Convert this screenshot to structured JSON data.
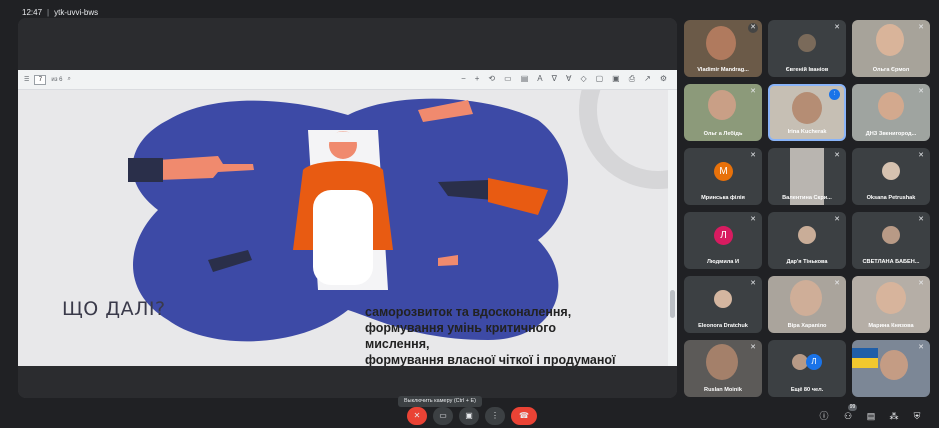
{
  "doc_toolbar": {
    "page": "7",
    "page_of": "из 6",
    "zoom_icon": "search-icon"
  },
  "slide": {
    "title": "ЩО ДАЛІ?",
    "lines": [
      " саморозвиток та вдосконалення,",
      "формування умінь критичного",
      "мислення,",
      "формування власної чіткої і продуманої"
    ],
    "colors": {
      "blob": "#3d4aa6",
      "sweater": "#e85b12",
      "skin": "#f08a6e",
      "sleeve": "#2a2f4a"
    }
  },
  "participants": [
    {
      "name": "Vladimir Mandrag...",
      "mic": "muted"
    },
    {
      "name": "Євгеній Іваніов",
      "mic": "muted"
    },
    {
      "name": "Ольга Єрмол",
      "mic": "muted"
    },
    {
      "name": "Ольг а Лебідь",
      "mic": "muted"
    },
    {
      "name": "Irina Kucherak",
      "mic": "speaking"
    },
    {
      "name": "ДНЗ Звенигород...",
      "mic": "muted"
    },
    {
      "name": "Мринська філія",
      "mic": "muted",
      "initial": "M",
      "color": "#e8710a"
    },
    {
      "name": "Валентина Скри...",
      "mic": "muted"
    },
    {
      "name": "Oksana Petrushak",
      "mic": "muted"
    },
    {
      "name": "Людмила И",
      "mic": "muted",
      "initial": "Л",
      "color": "#d81b60"
    },
    {
      "name": "Дар'я Тінькова",
      "mic": "muted"
    },
    {
      "name": "СВЕТЛАНА БАБЕН...",
      "mic": "muted"
    },
    {
      "name": "Eleonora Dratchuk",
      "mic": "muted"
    },
    {
      "name": "Віра Харапіло",
      "mic": "muted"
    },
    {
      "name": "Марина Князова",
      "mic": "muted"
    },
    {
      "name": "Ruslan Moinik",
      "mic": "muted"
    },
    {
      "name": "Ещё 80 чел.",
      "mic": "none",
      "initial": "Л"
    },
    {
      "name": "",
      "mic": "muted"
    }
  ],
  "bottom": {
    "time": "12:47",
    "meeting_code": "ytk-uvvi-bws",
    "tooltip": "Выключить камеру (Ctrl + E)",
    "people_count": "99"
  },
  "colors": {
    "end_call": "#ea4335",
    "mic_off": "#ea4335",
    "bar": "#202124",
    "tile": "#3c4043"
  }
}
